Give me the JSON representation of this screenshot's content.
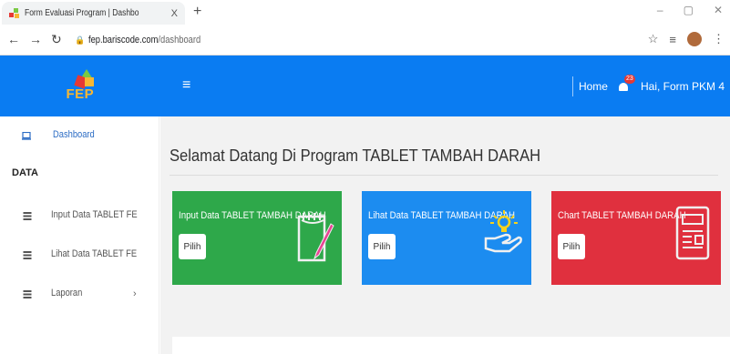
{
  "browser": {
    "tab_title": "Form Evaluasi Program | Dashbo",
    "tab_close": "X",
    "new_tab": "+",
    "url_host": "fep.bariscode.com",
    "url_path": "/dashboard"
  },
  "header": {
    "logo_text": "FEP",
    "menu_icon": "≡",
    "home_label": "Home",
    "notif_count": "23",
    "greeting": "Hai, Form PKM 4"
  },
  "sidebar": {
    "dashboard_label": "Dashboard",
    "section_data": "DATA",
    "items": [
      {
        "label": "Input Data TABLET FE"
      },
      {
        "label": "Lihat Data TABLET FE"
      },
      {
        "label": "Laporan"
      }
    ]
  },
  "main": {
    "welcome": "Selamat Datang Di Program TABLET TAMBAH DARAH",
    "cards": [
      {
        "title": "Input Data TABLET TAMBAH DARAH",
        "button": "Pilih",
        "color": "#2ea84a",
        "icon": "notepad-pencil-icon"
      },
      {
        "title": "Lihat Data TABLET TAMBAH DARAH",
        "button": "Pilih",
        "color": "#1c8cf0",
        "icon": "idea-hand-icon"
      },
      {
        "title": "Chart TABLET TAMBAH DARAH",
        "button": "Pilih",
        "color": "#e0303e",
        "icon": "newspaper-icon"
      }
    ]
  },
  "colors": {
    "topbar": "#0a7cf2",
    "sidebar_link": "#2b6cc4"
  }
}
